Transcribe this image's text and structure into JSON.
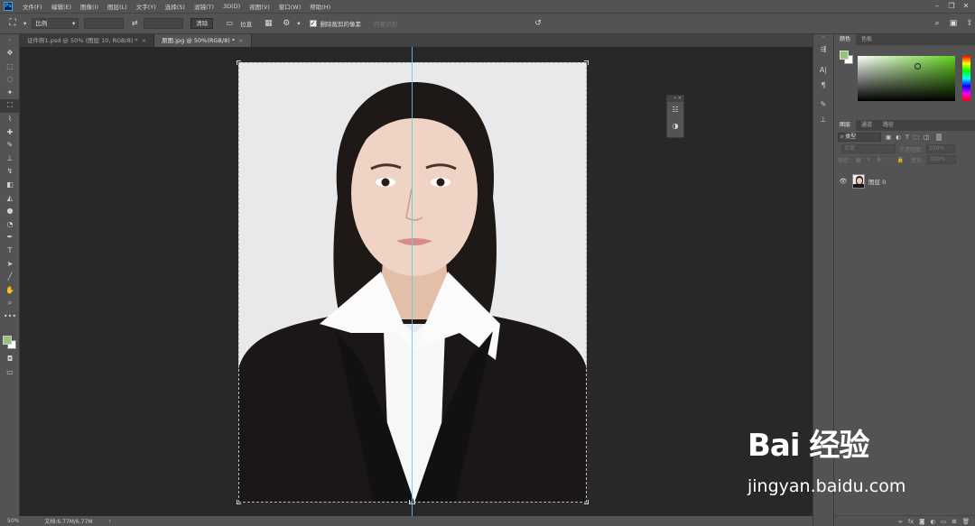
{
  "menubar": {
    "logo": "Ps",
    "items": [
      "文件(F)",
      "编辑(E)",
      "图像(I)",
      "图层(L)",
      "文字(Y)",
      "选择(S)",
      "滤镜(T)",
      "3D(D)",
      "视图(V)",
      "窗口(W)",
      "帮助(H)"
    ]
  },
  "optionsbar": {
    "ratio_label": "比例",
    "clear_label": "清除",
    "straighten_label": "拉直",
    "delete_cropped_label": "删除裁剪的像素",
    "content_aware_label": "内容识别"
  },
  "tabs": [
    {
      "label": "证件照1.psd @ 50% (图层 10, RGB/8) *",
      "active": false
    },
    {
      "label": "原图.jpg @ 50%(RGB/8) *",
      "active": true
    }
  ],
  "status": {
    "zoom": "50%",
    "doc_size": "文档:6.77M/6.77M"
  },
  "color_panel": {
    "tabs": [
      "颜色",
      "色板"
    ],
    "fg_color": "#93c47d",
    "bg_color": "#ffffff"
  },
  "layers_panel": {
    "tabs": [
      "图层",
      "通道",
      "路径"
    ],
    "filter_kind": "类型",
    "blend_mode": "正常",
    "opacity_label": "不透明度:",
    "opacity_value": "100%",
    "lock_label": "锁定:",
    "fill_label": "填充:",
    "fill_value": "100%",
    "layer_name": "图层 0"
  },
  "watermark": {
    "logo": "Bai 经验",
    "url": "jingyan.baidu.com"
  }
}
